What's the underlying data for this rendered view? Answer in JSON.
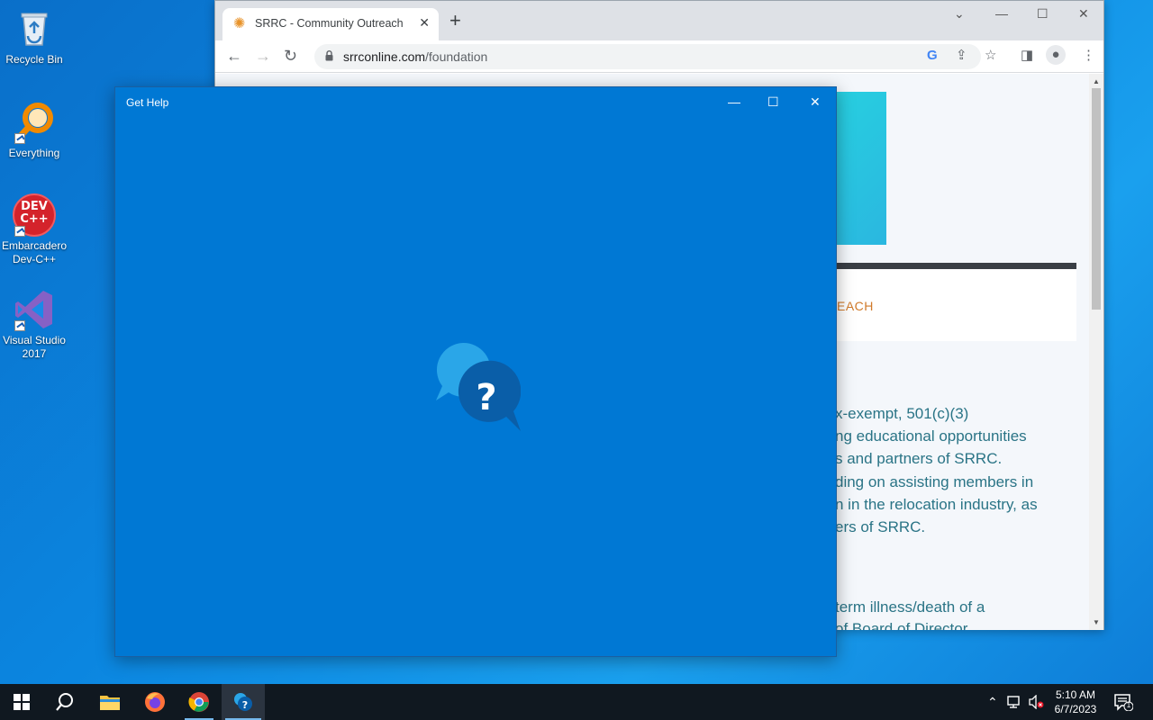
{
  "desktop": {
    "icons": [
      {
        "label": "Recycle Bin"
      },
      {
        "label": "Everything"
      },
      {
        "label": "Embarcadero Dev-C++",
        "logo_text": "DEV C++"
      },
      {
        "label": "Visual Studio 2017"
      }
    ]
  },
  "browser": {
    "tab_title": "SRRC - Community Outreach",
    "url_domain": "srrconline.com",
    "url_path": "/foundation",
    "page": {
      "nav_fragment": "EACH",
      "paragraph_lines": [
        "x-exempt, 501(c)(3)",
        "ng educational opportunities",
        "s and partners of SRRC.",
        "ding on assisting members in",
        "n in the relocation industry, as",
        "ers of SRRC."
      ],
      "paragraph2_lines": [
        "term illness/death of a",
        "of Board of Director"
      ]
    }
  },
  "gethelp": {
    "title": "Get Help"
  },
  "taskbar": {
    "time": "5:10 AM",
    "date": "6/7/2023",
    "notification_count": "1"
  },
  "colors": {
    "gethelp_bg": "#0078d4",
    "taskbar_bg": "#101820",
    "page_text": "#2a7486",
    "nav_accent": "#d07a2a"
  }
}
